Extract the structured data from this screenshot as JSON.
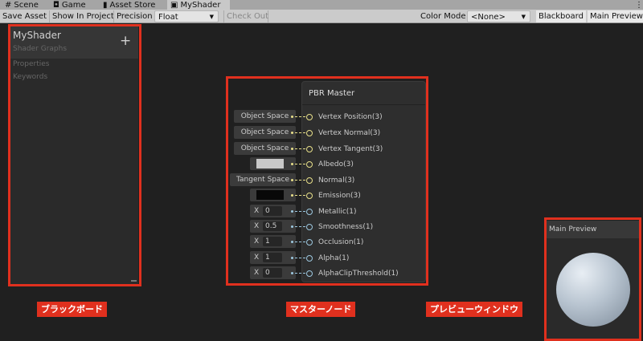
{
  "tabs": [
    {
      "label": "Scene",
      "icon": "grid-icon"
    },
    {
      "label": "Game",
      "icon": "gamepad-icon"
    },
    {
      "label": "Asset Store",
      "icon": "bag-icon"
    },
    {
      "label": "MyShader",
      "icon": "shader-icon",
      "active": true
    }
  ],
  "toolbar": {
    "save_asset": "Save Asset",
    "show_in_project": "Show In Project",
    "precision_label": "Precision",
    "precision_value": "Float",
    "check_out": "Check Out",
    "color_mode_label": "Color Mode",
    "color_mode_value": "<None>",
    "blackboard": "Blackboard",
    "main_preview": "Main Preview"
  },
  "blackboard": {
    "title": "MyShader",
    "subtitle": "Shader Graphs",
    "add": "+",
    "sections": [
      "Properties",
      "Keywords"
    ]
  },
  "node": {
    "title": "PBR Master",
    "ports": [
      {
        "label": "Vertex Position(3)",
        "input": "Object Space",
        "kind": "v"
      },
      {
        "label": "Vertex Normal(3)",
        "input": "Object Space",
        "kind": "v"
      },
      {
        "label": "Vertex Tangent(3)",
        "input": "Object Space",
        "kind": "v"
      },
      {
        "label": "Albedo(3)",
        "color": "#c8c8c8",
        "kind": "c"
      },
      {
        "label": "Normal(3)",
        "input": "Tangent Space",
        "kind": "v"
      },
      {
        "label": "Emission(3)",
        "color": "#080808",
        "kind": "c"
      },
      {
        "label": "Metallic(1)",
        "x": "0",
        "kind": "f"
      },
      {
        "label": "Smoothness(1)",
        "x": "0.5",
        "kind": "f"
      },
      {
        "label": "Occlusion(1)",
        "x": "1",
        "kind": "f"
      },
      {
        "label": "Alpha(1)",
        "x": "1",
        "kind": "f"
      },
      {
        "label": "AlphaClipThreshold(1)",
        "x": "0",
        "kind": "f"
      }
    ],
    "x_label": "X"
  },
  "preview": {
    "title": "Main Preview"
  },
  "annotations": {
    "blackboard": "ブラックボード",
    "master": "マスターノード",
    "preview": "プレビューウィンドウ"
  },
  "colors": {
    "highlight": "#e0301e"
  }
}
